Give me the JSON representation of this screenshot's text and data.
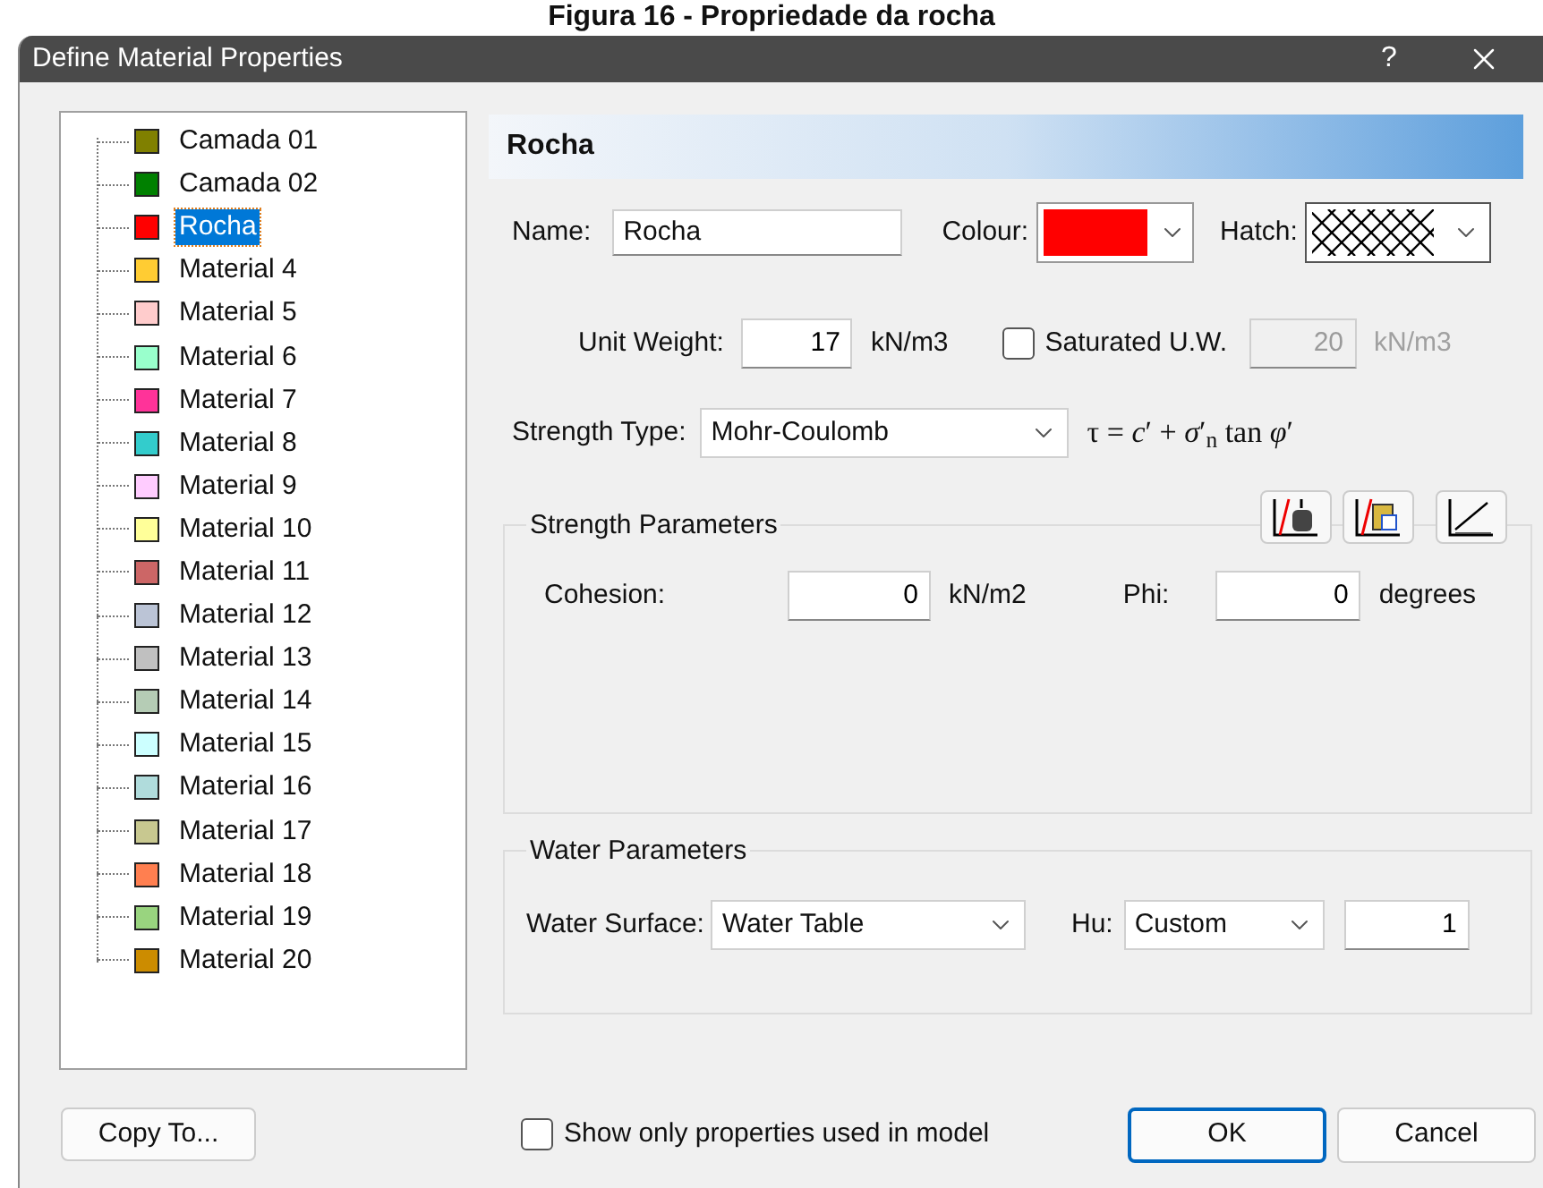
{
  "caption": "Figura 16 - Propriedade da rocha",
  "window": {
    "title": "Define Material Properties",
    "help": "?"
  },
  "materials": [
    {
      "label": "Camada 01",
      "color": "#808000",
      "selected": false
    },
    {
      "label": "Camada 02",
      "color": "#008000",
      "selected": false
    },
    {
      "label": "Rocha",
      "color": "#ff0000",
      "selected": true
    },
    {
      "label": "Material 4",
      "color": "#ffcc33",
      "selected": false
    },
    {
      "label": "Material 5",
      "color": "#ffcccc",
      "selected": false
    },
    {
      "label": "Material 6",
      "color": "#99ffcc",
      "selected": false
    },
    {
      "label": "Material 7",
      "color": "#ff3399",
      "selected": false
    },
    {
      "label": "Material 8",
      "color": "#33cccc",
      "selected": false
    },
    {
      "label": "Material 9",
      "color": "#ffccff",
      "selected": false
    },
    {
      "label": "Material 10",
      "color": "#ffff99",
      "selected": false
    },
    {
      "label": "Material 11",
      "color": "#cc6666",
      "selected": false
    },
    {
      "label": "Material 12",
      "color": "#bbc4d6",
      "selected": false
    },
    {
      "label": "Material 13",
      "color": "#c0c0c0",
      "selected": false
    },
    {
      "label": "Material 14",
      "color": "#b5ccb5",
      "selected": false
    },
    {
      "label": "Material 15",
      "color": "#ccffff",
      "selected": false
    },
    {
      "label": "Material 16",
      "color": "#b0dcdc",
      "selected": false
    },
    {
      "label": "Material 17",
      "color": "#c8c890",
      "selected": false
    },
    {
      "label": "Material 18",
      "color": "#ff7f50",
      "selected": false
    },
    {
      "label": "Material 19",
      "color": "#99d47f",
      "selected": false
    },
    {
      "label": "Material 20",
      "color": "#cc8c00",
      "selected": false
    }
  ],
  "header": "Rocha",
  "name": {
    "label": "Name:",
    "value": "Rocha"
  },
  "colour": {
    "label": "Colour:",
    "color": "#ff0000"
  },
  "hatch": {
    "label": "Hatch:"
  },
  "unit_weight": {
    "label": "Unit Weight:",
    "value": "17",
    "unit": "kN/m3"
  },
  "saturated": {
    "label": "Saturated U.W.",
    "checked": false,
    "value": "20",
    "unit": "kN/m3"
  },
  "strength_type": {
    "label": "Strength Type:",
    "value": "Mohr-Coulomb",
    "formula": "τ = *c*′ + *σ*′$_{n}$ tan *φ*′"
  },
  "strength_parameters": {
    "title": "Strength Parameters",
    "fields": [
      {
        "label": "Cohesion:",
        "value": "0",
        "unit": "kN/m2"
      },
      {
        "label": "Phi:",
        "value": "0",
        "unit": "degrees"
      }
    ]
  },
  "water_parameters": {
    "title": "Water Parameters",
    "surface": {
      "label": "Water Surface:",
      "value": "Water Table"
    },
    "hu": {
      "label": "Hu:",
      "value": "Custom",
      "number": "1"
    }
  },
  "footer": {
    "copy_button": "Copy To...",
    "show_only": {
      "label": "Show only properties used in model",
      "checked": false
    },
    "buttons": [
      {
        "label": "OK",
        "default": true
      },
      {
        "label": "Cancel",
        "default": false
      }
    ]
  }
}
